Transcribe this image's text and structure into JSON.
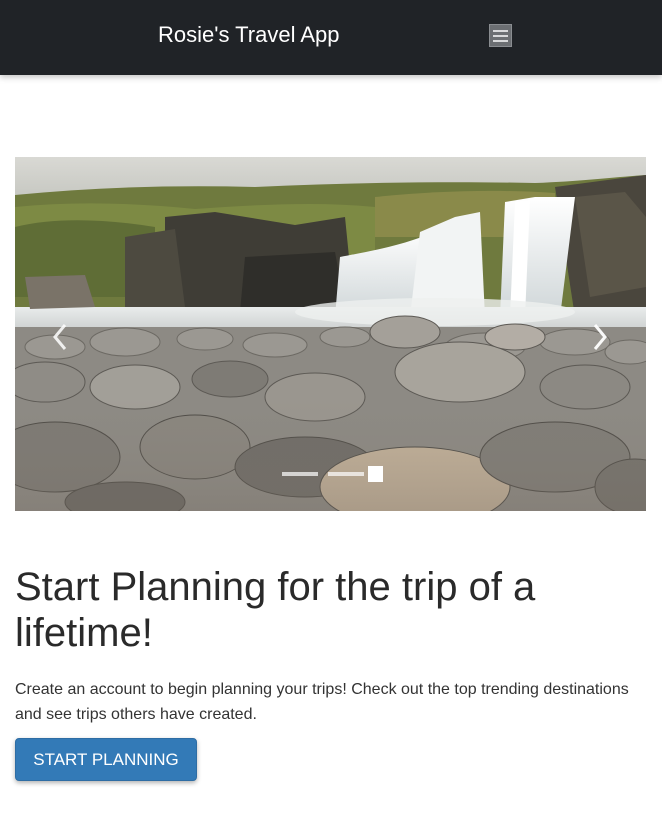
{
  "navbar": {
    "brand": "Rosie's Travel App",
    "menu_icon": "hamburger-menu-icon"
  },
  "carousel": {
    "image_description_icon": "waterfall-photo",
    "prev_icon": "chevron-left-icon",
    "next_icon": "chevron-right-icon",
    "slide_count": 3,
    "active_slide": 3
  },
  "hero": {
    "title": "Start Planning for the trip of a lifetime!",
    "text": "Create an account to begin planning your trips! Check out the top trending destinations and see trips others have created.",
    "button_label": "START PLANNING"
  },
  "colors": {
    "navbar_bg": "#202327",
    "button_bg": "#337ab7",
    "text": "#2a2a2a"
  }
}
